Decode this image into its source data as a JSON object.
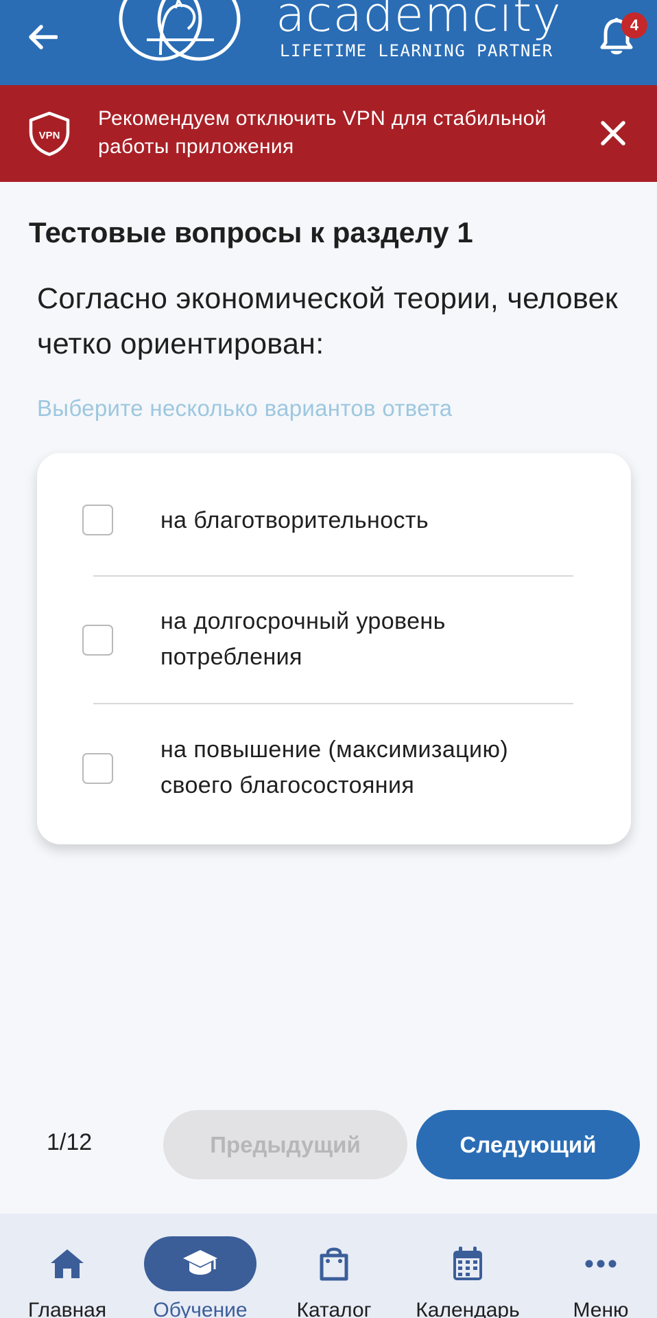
{
  "header": {
    "logo_name": "academcity",
    "logo_tagline": "LIFETIME LEARNING PARTNER",
    "notification_count": "4",
    "colors": {
      "brand": "#2a6db5",
      "badge": "#c5282a"
    }
  },
  "vpn_banner": {
    "icon_text": "VPN",
    "message": "Рекомендуем отключить VPN для стабильной работы приложения",
    "color": "#a82026"
  },
  "quiz": {
    "section_title": "Тестовые вопросы к разделу 1",
    "question": "Согласно экономической теории, человек четко ориентирован:",
    "hint": "Выберите несколько вариантов ответа",
    "options": [
      {
        "label": "на благотворительность",
        "checked": false
      },
      {
        "label": "на долгосрочный уровень потребления",
        "checked": false
      },
      {
        "label": "на повышение (максимизацию) своего благосостояния",
        "checked": false
      }
    ]
  },
  "pager": {
    "counter": "1/12",
    "prev_label": "Предыдущий",
    "next_label": "Следующий"
  },
  "bottom_nav": {
    "items": [
      {
        "label": "Главная",
        "icon": "home-icon",
        "active": false
      },
      {
        "label": "Обучение",
        "icon": "graduation-cap-icon",
        "active": true
      },
      {
        "label": "Каталог",
        "icon": "shopping-bag-icon",
        "active": false
      },
      {
        "label": "Календарь",
        "icon": "calendar-icon",
        "active": false
      },
      {
        "label": "Меню",
        "icon": "more-dots-icon",
        "active": false
      }
    ],
    "active_color": "#3b5e99"
  }
}
